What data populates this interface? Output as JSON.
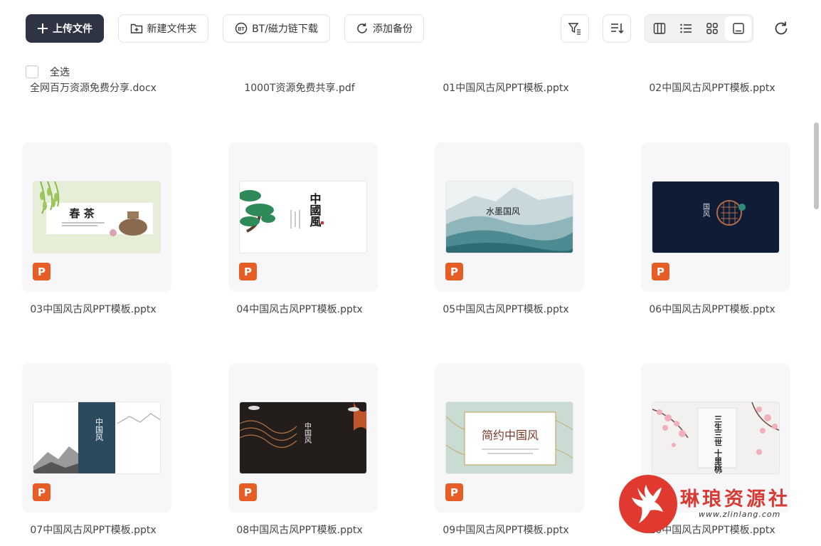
{
  "toolbar": {
    "upload_label": "上传文件",
    "new_folder_label": "新建文件夹",
    "bt_label": "BT/磁力链下载",
    "backup_label": "添加备份"
  },
  "select_all_label": "全选",
  "prev_row_files": [
    "全网百万资源免费分享.docx",
    "1000T资源免费共享.pdf",
    "01中国风古风PPT模板.pptx",
    "02中国风古风PPT模板.pptx"
  ],
  "files": [
    {
      "name": "03中国风古风PPT模板.pptx",
      "thumb_title": "春 茶"
    },
    {
      "name": "04中国风古风PPT模板.pptx",
      "thumb_title": "中國風"
    },
    {
      "name": "05中国风古风PPT模板.pptx",
      "thumb_title": "水墨国风"
    },
    {
      "name": "06中国风古风PPT模板.pptx",
      "thumb_title": "国风"
    },
    {
      "name": "07中国风古风PPT模板.pptx",
      "thumb_title": "中国风"
    },
    {
      "name": "08中国风古风PPT模板.pptx",
      "thumb_title": "中国风"
    },
    {
      "name": "09中国风古风PPT模板.pptx",
      "thumb_title": "简约中国风"
    },
    {
      "name": "10中国风古风PPT模板.pptx",
      "thumb_title": "三生三世 十里桃花"
    }
  ],
  "ppt_icon_letter": "P",
  "watermark": {
    "name": "琳琅资源社",
    "url": "www.zlinlang.com"
  },
  "colors": {
    "primary_button": "#2f3445",
    "ppt_icon": "#e65d25",
    "card_bg": "#f7f7f9",
    "watermark_red": "#d83a34"
  }
}
